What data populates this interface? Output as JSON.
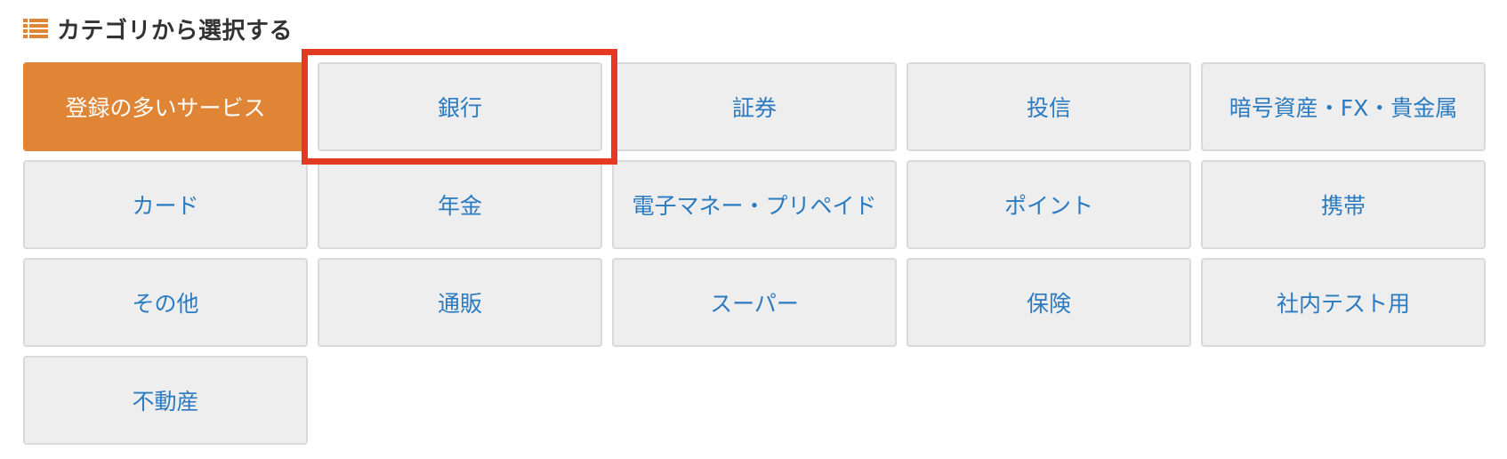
{
  "heading": {
    "title": "カテゴリから選択する",
    "icon": "list-icon"
  },
  "colors": {
    "accent": "#e08536",
    "link": "#2b7bc1",
    "highlight": "#e53a22",
    "button_bg": "#eeeeee"
  },
  "categories": [
    {
      "label": "登録の多いサービス",
      "active": true
    },
    {
      "label": "銀行",
      "active": false
    },
    {
      "label": "証券",
      "active": false
    },
    {
      "label": "投信",
      "active": false
    },
    {
      "label": "暗号資産・FX・貴金属",
      "active": false
    },
    {
      "label": "カード",
      "active": false
    },
    {
      "label": "年金",
      "active": false
    },
    {
      "label": "電子マネー・プリペイド",
      "active": false
    },
    {
      "label": "ポイント",
      "active": false
    },
    {
      "label": "携帯",
      "active": false
    },
    {
      "label": "その他",
      "active": false
    },
    {
      "label": "通販",
      "active": false
    },
    {
      "label": "スーパー",
      "active": false
    },
    {
      "label": "保険",
      "active": false
    },
    {
      "label": "社内テスト用",
      "active": false
    },
    {
      "label": "不動産",
      "active": false
    }
  ]
}
